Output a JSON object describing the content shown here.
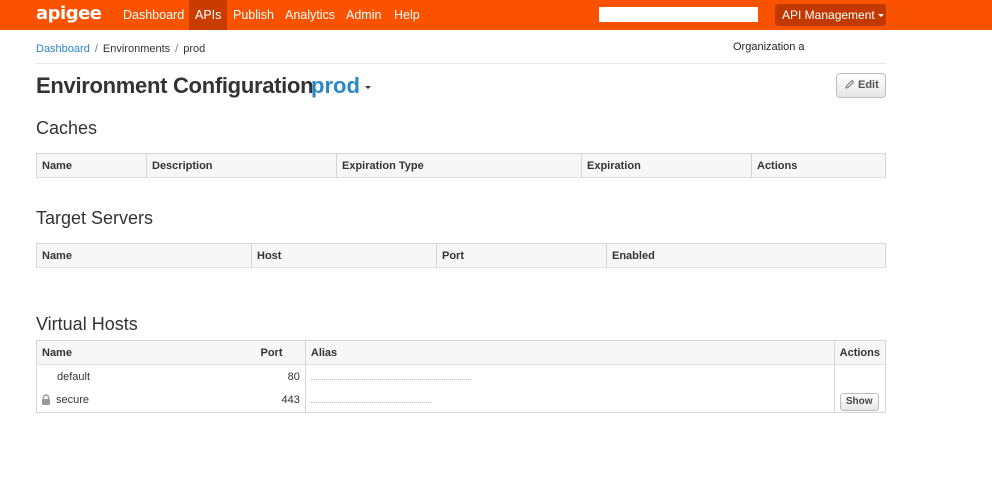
{
  "navbar": {
    "brand": "apigee",
    "items": [
      {
        "label": "Dashboard"
      },
      {
        "label": "APIs"
      },
      {
        "label": "Publish"
      },
      {
        "label": "Analytics"
      },
      {
        "label": "Admin"
      },
      {
        "label": "Help"
      }
    ],
    "active_item": "APIs",
    "search_value": "",
    "api_management_label": "API Management",
    "colors": {
      "bar": "#fb5200",
      "active": "#c83c00",
      "button": "#c13800"
    }
  },
  "breadcrumb": {
    "items": [
      "Dashboard",
      "Environments",
      "prod"
    ],
    "separator": "/"
  },
  "organization_label": "Organization a",
  "page": {
    "title": "Environment Configuration",
    "environment": "prod",
    "edit_label": "Edit",
    "accent_color": "#2a88c9"
  },
  "caches": {
    "title": "Caches",
    "columns": [
      "Name",
      "Description",
      "Expiration Type",
      "Expiration",
      "Actions"
    ]
  },
  "target_servers": {
    "title": "Target Servers",
    "columns": [
      "Name",
      "Host",
      "Port",
      "Enabled"
    ]
  },
  "virtual_hosts": {
    "title": "Virtual Hosts",
    "columns": [
      "Name",
      "Port",
      "Alias",
      "Actions"
    ],
    "rows": [
      {
        "name": "default",
        "port": "80",
        "locked": false,
        "action": ""
      },
      {
        "name": "secure",
        "port": "443",
        "locked": true,
        "action": "Show"
      }
    ]
  },
  "icons": {
    "edit": "pencil-icon",
    "lock": "lock-icon",
    "env_dropdown": "chevron-down-icon"
  }
}
